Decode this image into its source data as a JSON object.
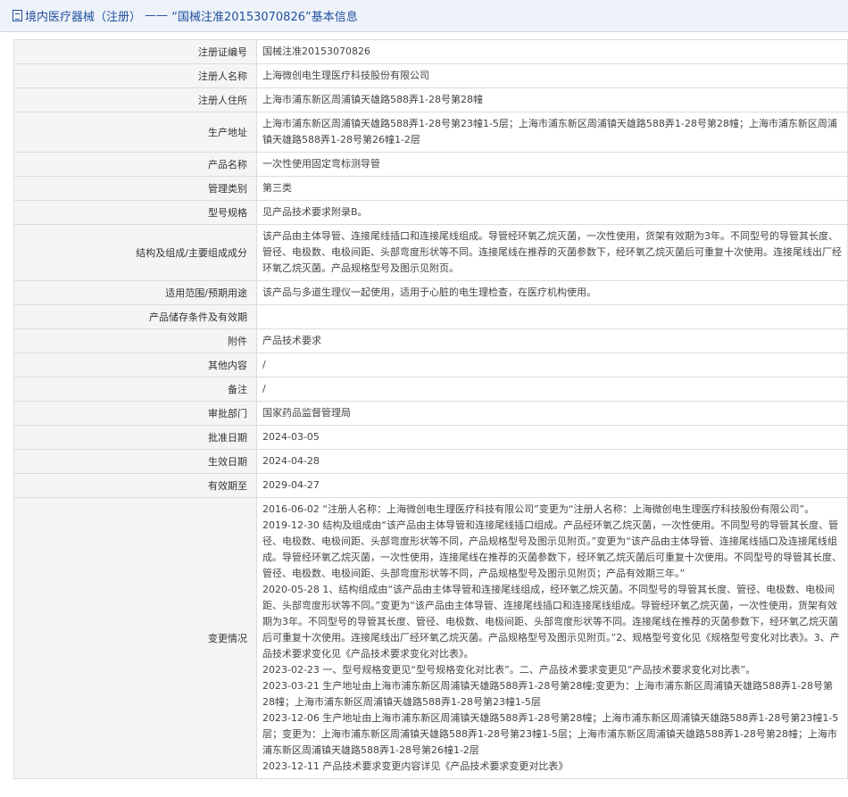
{
  "header": {
    "prefix": "境内医疗器械（注册）",
    "dash": " —— ",
    "reg_quoted": "“国械注准20153070826”",
    "suffix": "基本信息"
  },
  "rows": [
    {
      "label": "注册证编号",
      "value": "国械注准20153070826"
    },
    {
      "label": "注册人名称",
      "value": "上海微创电生理医疗科技股份有限公司"
    },
    {
      "label": "注册人住所",
      "value": "上海市浦东新区周浦镇天雄路588弄1-28号第28幢"
    },
    {
      "label": "生产地址",
      "value": "上海市浦东新区周浦镇天雄路588弄1-28号第23幢1-5层；上海市浦东新区周浦镇天雄路588弄1-28号第28幢；上海市浦东新区周浦镇天雄路588弄1-28号第26幢1-2层"
    },
    {
      "label": "产品名称",
      "value": "一次性使用固定弯标测导管"
    },
    {
      "label": "管理类别",
      "value": "第三类"
    },
    {
      "label": "型号规格",
      "value": "见产品技术要求附录B。"
    },
    {
      "label": "结构及组成/主要组成成分",
      "value": "该产品由主体导管、连接尾线插口和连接尾线组成。导管经环氧乙烷灭菌，一次性使用，货架有效期为3年。不同型号的导管其长度、管径、电极数、电极间距、头部弯度形状等不同。连接尾线在推荐的灭菌参数下，经环氧乙烷灭菌后可重复十次使用。连接尾线出厂经环氧乙烷灭菌。产品规格型号及图示见附页。"
    },
    {
      "label": "适用范围/预期用途",
      "value": "该产品与多道生理仪一起使用，适用于心脏的电生理检查，在医疗机构使用。"
    },
    {
      "label": "产品储存条件及有效期",
      "value": ""
    },
    {
      "label": "附件",
      "value": "产品技术要求"
    },
    {
      "label": "其他内容",
      "value": "/"
    },
    {
      "label": "备注",
      "value": "/"
    },
    {
      "label": "审批部门",
      "value": "国家药品监督管理局"
    },
    {
      "label": "批准日期",
      "value": "2024-03-05"
    },
    {
      "label": "生效日期",
      "value": "2024-04-28"
    },
    {
      "label": "有效期至",
      "value": "2029-04-27"
    }
  ],
  "changes": {
    "label": "变更情况",
    "entries": [
      "2016-06-02 “注册人名称：上海微创电生理医疗科技有限公司”变更为“注册人名称：上海微创电生理医疗科技股份有限公司”。",
      "2019-12-30 结构及组成由“该产品由主体导管和连接尾线插口组成。产品经环氧乙烷灭菌，一次性使用。不同型号的导管其长度、管径、电极数、电极间距、头部弯度形状等不同，产品规格型号及图示见附页。”变更为“该产品由主体导管、连接尾线插口及连接尾线组成。导管经环氧乙烷灭菌，一次性使用，连接尾线在推荐的灭菌参数下，经环氧乙烷灭菌后可重复十次使用。不同型号的导管其长度、管径、电极数、电极间距、头部弯度形状等不同，产品规格型号及图示见附页；产品有效期三年。”",
      "2020-05-28 1、结构组成由“该产品由主体导管和连接尾线组成，经环氧乙烷灭菌。不同型号的导管其长度、管径、电极数、电极间距、头部弯度形状等不同。”变更为“该产品由主体导管、连接尾线插口和连接尾线组成。导管经环氧乙烷灭菌，一次性使用，货架有效期为3年。不同型号的导管其长度、管径、电极数、电极间距、头部弯度形状等不同。连接尾线在推荐的灭菌参数下，经环氧乙烷灭菌后可重复十次使用。连接尾线出厂经环氧乙烷灭菌。产品规格型号及图示见附页。”2、规格型号变化见《规格型号变化对比表》。3、产品技术要求变化见《产品技术要求变化对比表》。",
      "2023-02-23 一、型号规格变更见“型号规格变化对比表”。二、产品技术要求变更见“产品技术要求变化对比表”。",
      "2023-03-21 生产地址由上海市浦东新区周浦镇天雄路588弄1-28号第28幢;变更为：上海市浦东新区周浦镇天雄路588弄1-28号第28幢；上海市浦东新区周浦镇天雄路588弄1-28号第23幢1-5层",
      "2023-12-06 生产地址由上海市浦东新区周浦镇天雄路588弄1-28号第28幢；上海市浦东新区周浦镇天雄路588弄1-28号第23幢1-5层；变更为：上海市浦东新区周浦镇天雄路588弄1-28号第23幢1-5层；上海市浦东新区周浦镇天雄路588弄1-28号第28幢；上海市浦东新区周浦镇天雄路588弄1-28号第26幢1-2层",
      "2023-12-11 产品技术要求变更内容详见《产品技术要求变更对比表》"
    ]
  }
}
